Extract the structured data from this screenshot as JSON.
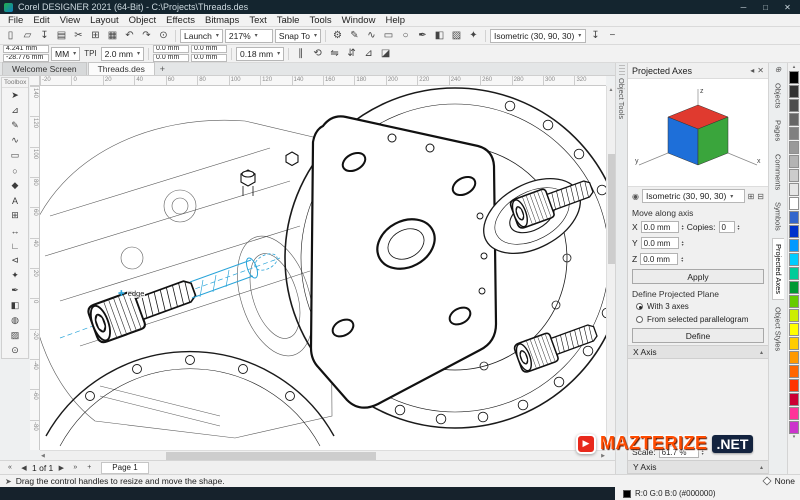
{
  "window": {
    "title": "Corel DESIGNER 2021 (64-Bit) - C:\\Projects\\Threads.des",
    "minimize": "─",
    "maximize": "□",
    "close": "✕"
  },
  "menu": {
    "items": [
      "File",
      "Edit",
      "View",
      "Layout",
      "Object",
      "Effects",
      "Bitmaps",
      "Text",
      "Table",
      "Tools",
      "Window",
      "Help"
    ]
  },
  "toolbar": {
    "file_icons": [
      {
        "name": "new-document-icon",
        "glyph": "▯"
      },
      {
        "name": "open-icon",
        "glyph": "▱"
      },
      {
        "name": "save-icon",
        "glyph": "↧"
      },
      {
        "name": "print-icon",
        "glyph": "▤"
      },
      {
        "name": "cut-icon",
        "glyph": "✂"
      },
      {
        "name": "copy-icon",
        "glyph": "⊞"
      },
      {
        "name": "paste-icon",
        "glyph": "▦"
      },
      {
        "name": "undo-icon",
        "glyph": "↶"
      },
      {
        "name": "redo-icon",
        "glyph": "↷"
      },
      {
        "name": "search-icon",
        "glyph": "⊙"
      }
    ],
    "launch_label": "Launch",
    "zoom_value": "217%",
    "snap_label": "Snap To",
    "tool_icons": [
      {
        "name": "options-gear-icon",
        "glyph": "⚙"
      },
      {
        "name": "curve-tool-icon",
        "glyph": "✎"
      },
      {
        "name": "bezier-tool-icon",
        "glyph": "∿"
      },
      {
        "name": "rectangle-tool-icon",
        "glyph": "▭"
      },
      {
        "name": "ellipse-tool-icon",
        "glyph": "○"
      },
      {
        "name": "outline-pen-icon",
        "glyph": "✒"
      },
      {
        "name": "fill-tool-icon",
        "glyph": "◧"
      },
      {
        "name": "transparency-tool-icon",
        "glyph": "▨"
      },
      {
        "name": "eyedropper-icon",
        "glyph": "✦"
      }
    ],
    "projection_value": "Isometric (30, 90, 30)",
    "preset_icons": [
      {
        "name": "save-preset-icon",
        "glyph": "↧"
      },
      {
        "name": "remove-preset-icon",
        "glyph": "−"
      }
    ]
  },
  "propertybar": {
    "x_value": "4.241 mm",
    "y_value": "-28.776 mm",
    "units_value": "MM",
    "tpi_label": "TPI",
    "pitch_value": "2.0 mm",
    "w_value": "0.0 mm",
    "h_value": "0.0 mm",
    "w2_value": "0.0 mm",
    "h2_value": "0.0 mm",
    "outline_width": "0.18 mm",
    "icons": [
      {
        "name": "lock-ratio-icon",
        "glyph": "∥"
      },
      {
        "name": "rotate-icon",
        "glyph": "⟲"
      },
      {
        "name": "mirror-horizontal-icon",
        "glyph": "⇋"
      },
      {
        "name": "mirror-vertical-icon",
        "glyph": "⇵"
      },
      {
        "name": "wireframe-view-icon",
        "glyph": "⊿"
      },
      {
        "name": "enhanced-view-icon",
        "glyph": "◪"
      }
    ]
  },
  "tabbar": {
    "welcome_tab": "Welcome Screen",
    "document_tab": "Threads.des",
    "new_tab": "+"
  },
  "rulers": {
    "h_numbers": [
      "-20",
      "0",
      "20",
      "40",
      "60",
      "80",
      "100",
      "120",
      "140",
      "160",
      "180",
      "200",
      "220",
      "240",
      "260",
      "280",
      "300",
      "320"
    ],
    "v_numbers": [
      "140",
      "120",
      "100",
      "80",
      "60",
      "40",
      "20",
      "0",
      "-20",
      "-40",
      "-60",
      "-80"
    ]
  },
  "toolbox": {
    "title": "Toolbox",
    "tools": [
      {
        "name": "pick-tool",
        "glyph": "➤"
      },
      {
        "name": "shape-tool",
        "glyph": "⊿"
      },
      {
        "name": "curve-tool",
        "glyph": "✎"
      },
      {
        "name": "smart-drawing-tool",
        "glyph": "∿"
      },
      {
        "name": "rectangle-tool",
        "glyph": "▭"
      },
      {
        "name": "ellipse-tool",
        "glyph": "○"
      },
      {
        "name": "polygon-tool",
        "glyph": "◆"
      },
      {
        "name": "text-tool",
        "glyph": "A"
      },
      {
        "name": "table-tool",
        "glyph": "⊞"
      },
      {
        "name": "dimension-tool",
        "glyph": "↔"
      },
      {
        "name": "connector-tool",
        "glyph": "∟"
      },
      {
        "name": "callout-tool",
        "glyph": "⊲"
      },
      {
        "name": "eyedropper-tool",
        "glyph": "✦"
      },
      {
        "name": "outline-pen-tool",
        "glyph": "✒"
      },
      {
        "name": "fill-tool",
        "glyph": "◧"
      },
      {
        "name": "interactive-fill-tool",
        "glyph": "◍"
      },
      {
        "name": "transparency-tool",
        "glyph": "▨"
      },
      {
        "name": "zoom-tool",
        "glyph": "⊙"
      }
    ]
  },
  "object_toolbar": {
    "label": "Object Tools"
  },
  "docker": {
    "title": "Projected Axes",
    "preset_value": "Isometric (30, 90, 30)",
    "move_section": "Move along axis",
    "axes": [
      {
        "label": "X",
        "value": "0.0 mm"
      },
      {
        "label": "Y",
        "value": "0.0 mm"
      },
      {
        "label": "Z",
        "value": "0.0 mm"
      }
    ],
    "copies_label": "Copies:",
    "copies_value": "0",
    "apply_label": "Apply",
    "define_section": "Define Projected Plane",
    "radio_axes": "With 3 axes",
    "radio_parallelogram": "From selected parallelogram",
    "define_label": "Define",
    "x_axis_section": "X Axis",
    "scale_label": "Scale:",
    "scale_value": "61.7 %",
    "y_axis_section": "Y Axis",
    "cube": {
      "x": "x",
      "y": "y",
      "z": "z",
      "top_color": "#e03a2f",
      "left_color": "#1e6fd9",
      "right_color": "#3aa53c"
    }
  },
  "side_tabs": {
    "items": [
      "Objects",
      "Pages",
      "Comments",
      "Symbols",
      "Projected Axes",
      "Object Styles"
    ]
  },
  "palette": {
    "colors": [
      "#000000",
      "#333333",
      "#4d4d4d",
      "#666666",
      "#808080",
      "#999999",
      "#b3b3b3",
      "#cccccc",
      "#e6e6e6",
      "#ffffff",
      "#3366cc",
      "#0033cc",
      "#0099ff",
      "#00ccff",
      "#00cc99",
      "#009933",
      "#66cc00",
      "#ccee00",
      "#ffff00",
      "#ffcc00",
      "#ff9900",
      "#ff6600",
      "#ff3300",
      "#cc0033",
      "#ff3399",
      "#cc33cc"
    ]
  },
  "canvas": {
    "snap_tooltip": "edge"
  },
  "pagebar": {
    "first": "«",
    "prev": "◀",
    "info": "1 of 1",
    "next": "▶",
    "last": "»",
    "page_tab": "Page 1",
    "add": "+"
  },
  "statusbar": {
    "hint": "Drag the control handles to resize and move the shape.",
    "fill_label": "None",
    "outline_value": "R:0 G:0 B:0 (#000000)"
  },
  "watermark": {
    "play": "▶",
    "brand": "MAZTERIZE",
    "suffix": ".NET"
  }
}
